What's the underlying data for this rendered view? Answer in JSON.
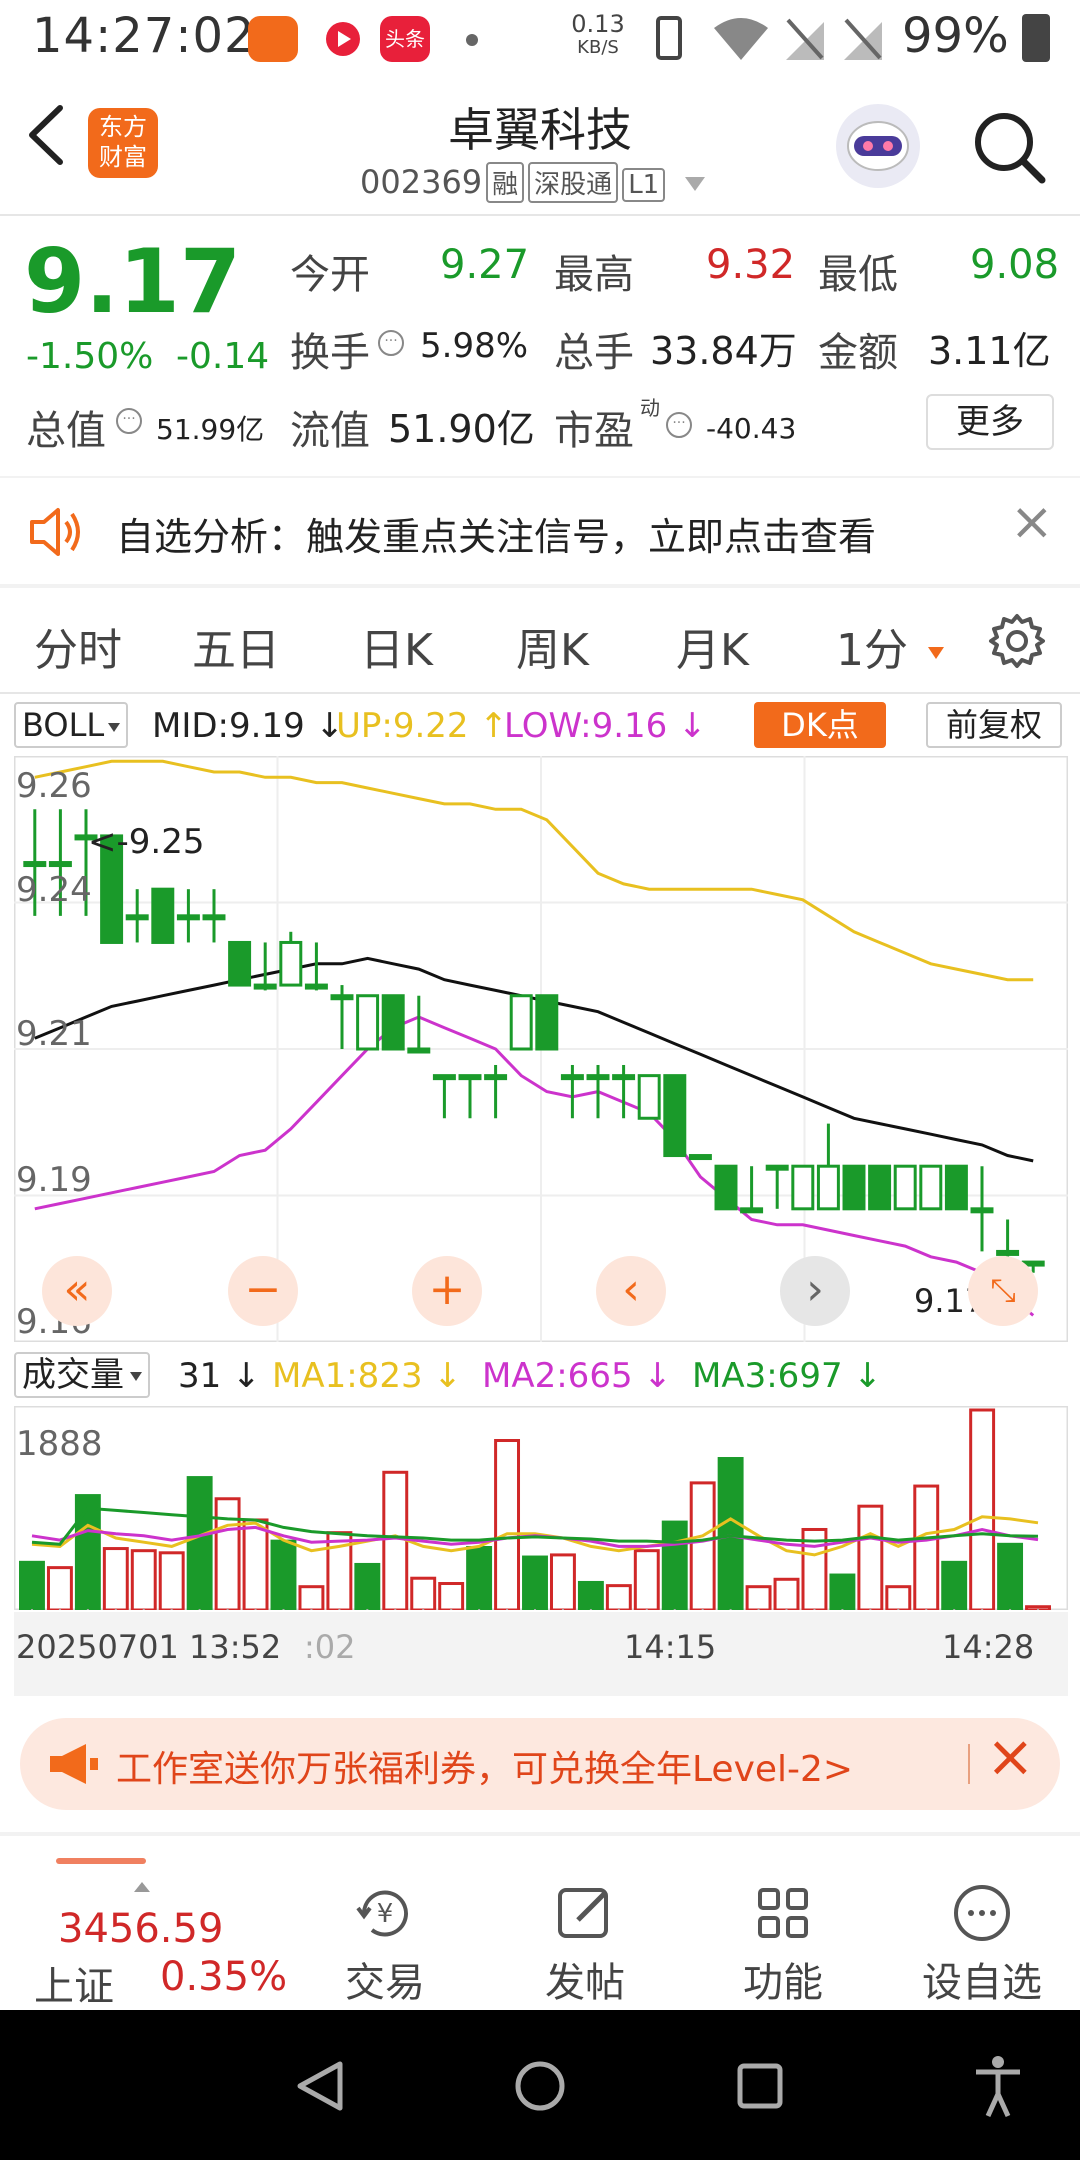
{
  "status": {
    "time": "14:27:02",
    "net_speed_top": "0.13",
    "net_speed_unit": "KB/S",
    "battery": "99%",
    "app_badge_text": "头条"
  },
  "header": {
    "back_label": "‹",
    "logo_text_1": "东方",
    "logo_text_2": "财富",
    "title": "卓翼科技",
    "code": "002369",
    "tag1": "融",
    "tag2": "深股通",
    "tag3": "L1"
  },
  "quote": {
    "price": "9.17",
    "change_pct": "-1.50%",
    "change_val": "-0.14",
    "open_label": "今开",
    "open": "9.27",
    "high_label": "最高",
    "high": "9.32",
    "low_label": "最低",
    "low": "9.08",
    "turnover_label": "换手",
    "turnover": "5.98%",
    "volume_label": "总手",
    "volume": "33.84万",
    "amount_label": "金额",
    "amount": "3.11亿",
    "mktcap_label": "总值",
    "mktcap": "51.99亿",
    "float_label": "流值",
    "float": "51.90亿",
    "pe_label": "市盈",
    "pe_sup": "动",
    "pe": "-40.43",
    "more_label": "更多"
  },
  "notice": {
    "text": "自选分析：触发重点关注信号，立即点击查看",
    "close": "×"
  },
  "tabs": [
    "分时",
    "五日",
    "日K",
    "周K",
    "月K",
    "1分"
  ],
  "indicator": {
    "name": "BOLL",
    "mid": "MID:9.19",
    "up": "UP:9.22",
    "low": "LOW:9.16",
    "dk": "DK点",
    "fq": "前复权"
  },
  "chart_labels": {
    "y_top": "9.26",
    "y2": "9.24",
    "y3": "9.21",
    "y4": "9.19",
    "y5": "9.16",
    "max_mark": "<-9.25",
    "last_mark": "9.17->"
  },
  "volume": {
    "name": "成交量",
    "value": "31",
    "ma1": "MA1:823",
    "ma2": "MA2:665",
    "ma3": "MA3:697",
    "y_max": "1888"
  },
  "time_axis": {
    "start": "20250701 13:52",
    "fragment": ":02",
    "mid": "14:15",
    "end": "14:28"
  },
  "banner": {
    "text": "工作室送你万张福利券，可兑换全年Level-2>",
    "close": "×"
  },
  "index": {
    "value": "3456.59",
    "name": "上证",
    "pct": "0.35%"
  },
  "bottom_nav": [
    "交易",
    "发帖",
    "功能",
    "设自选"
  ],
  "colors": {
    "up": "#d02828",
    "down": "#1a9a2a",
    "mid_line": "#111111",
    "up_line": "#e8c020",
    "low_line": "#cc33cc",
    "accent": "#f26a1b"
  },
  "chart_data": {
    "type": "candlestick",
    "ylim": [
      9.155,
      9.265
    ],
    "candles": [
      {
        "o": 9.245,
        "c": 9.245,
        "h": 9.255,
        "l": 9.235
      },
      {
        "o": 9.245,
        "c": 9.245,
        "h": 9.255,
        "l": 9.235
      },
      {
        "o": 9.25,
        "c": 9.25,
        "h": 9.255,
        "l": 9.235
      },
      {
        "o": 9.25,
        "c": 9.23,
        "h": 9.25,
        "l": 9.23
      },
      {
        "o": 9.235,
        "c": 9.235,
        "h": 9.24,
        "l": 9.23
      },
      {
        "o": 9.24,
        "c": 9.23,
        "h": 9.24,
        "l": 9.23
      },
      {
        "o": 9.235,
        "c": 9.235,
        "h": 9.24,
        "l": 9.23
      },
      {
        "o": 9.235,
        "c": 9.235,
        "h": 9.24,
        "l": 9.23
      },
      {
        "o": 9.23,
        "c": 9.222,
        "h": 9.23,
        "l": 9.222
      },
      {
        "o": 9.222,
        "c": 9.222,
        "h": 9.23,
        "l": 9.221
      },
      {
        "o": 9.222,
        "c": 9.23,
        "h": 9.232,
        "l": 9.222
      },
      {
        "o": 9.222,
        "c": 9.222,
        "h": 9.23,
        "l": 9.221
      },
      {
        "o": 9.22,
        "c": 9.22,
        "h": 9.222,
        "l": 9.21
      },
      {
        "o": 9.21,
        "c": 9.22,
        "h": 9.22,
        "l": 9.21
      },
      {
        "o": 9.22,
        "c": 9.21,
        "h": 9.22,
        "l": 9.21
      },
      {
        "o": 9.21,
        "c": 9.21,
        "h": 9.22,
        "l": 9.21
      },
      {
        "o": 9.205,
        "c": 9.205,
        "h": 9.205,
        "l": 9.197
      },
      {
        "o": 9.205,
        "c": 9.205,
        "h": 9.205,
        "l": 9.197
      },
      {
        "o": 9.205,
        "c": 9.205,
        "h": 9.207,
        "l": 9.197
      },
      {
        "o": 9.21,
        "c": 9.22,
        "h": 9.22,
        "l": 9.21
      },
      {
        "o": 9.22,
        "c": 9.21,
        "h": 9.22,
        "l": 9.21
      },
      {
        "o": 9.205,
        "c": 9.205,
        "h": 9.207,
        "l": 9.197
      },
      {
        "o": 9.205,
        "c": 9.205,
        "h": 9.207,
        "l": 9.197
      },
      {
        "o": 9.205,
        "c": 9.205,
        "h": 9.207,
        "l": 9.197
      },
      {
        "o": 9.197,
        "c": 9.205,
        "h": 9.205,
        "l": 9.197
      },
      {
        "o": 9.205,
        "c": 9.19,
        "h": 9.205,
        "l": 9.19
      },
      {
        "o": 9.19,
        "c": 9.19,
        "h": 9.19,
        "l": 9.19
      },
      {
        "o": 9.188,
        "c": 9.18,
        "h": 9.188,
        "l": 9.18
      },
      {
        "o": 9.18,
        "c": 9.18,
        "h": 9.188,
        "l": 9.18
      },
      {
        "o": 9.188,
        "c": 9.188,
        "h": 9.188,
        "l": 9.18
      },
      {
        "o": 9.18,
        "c": 9.188,
        "h": 9.188,
        "l": 9.18
      },
      {
        "o": 9.18,
        "c": 9.188,
        "h": 9.196,
        "l": 9.18
      },
      {
        "o": 9.188,
        "c": 9.18,
        "h": 9.188,
        "l": 9.18
      },
      {
        "o": 9.188,
        "c": 9.18,
        "h": 9.188,
        "l": 9.18
      },
      {
        "o": 9.18,
        "c": 9.188,
        "h": 9.188,
        "l": 9.18
      },
      {
        "o": 9.18,
        "c": 9.188,
        "h": 9.188,
        "l": 9.18
      },
      {
        "o": 9.188,
        "c": 9.18,
        "h": 9.188,
        "l": 9.18
      },
      {
        "o": 9.18,
        "c": 9.18,
        "h": 9.188,
        "l": 9.172
      },
      {
        "o": 9.172,
        "c": 9.172,
        "h": 9.178,
        "l": 9.165
      },
      {
        "o": 9.17,
        "c": 9.17,
        "h": 9.17,
        "l": 9.168
      }
    ],
    "mid_line": [
      9.212,
      9.214,
      9.216,
      9.218,
      9.219,
      9.22,
      9.221,
      9.222,
      9.223,
      9.224,
      9.225,
      9.226,
      9.226,
      9.227,
      9.226,
      9.225,
      9.223,
      9.222,
      9.221,
      9.22,
      9.219,
      9.218,
      9.217,
      9.215,
      9.213,
      9.211,
      9.209,
      9.207,
      9.205,
      9.203,
      9.201,
      9.199,
      9.197,
      9.196,
      9.195,
      9.194,
      9.193,
      9.192,
      9.19,
      9.189
    ],
    "up_line": [
      9.261,
      9.262,
      9.263,
      9.264,
      9.264,
      9.264,
      9.263,
      9.262,
      9.262,
      9.261,
      9.261,
      9.26,
      9.26,
      9.259,
      9.258,
      9.257,
      9.256,
      9.256,
      9.255,
      9.255,
      9.253,
      9.248,
      9.243,
      9.241,
      9.24,
      9.24,
      9.24,
      9.24,
      9.24,
      9.239,
      9.238,
      9.235,
      9.232,
      9.23,
      9.228,
      9.226,
      9.225,
      9.224,
      9.223,
      9.223
    ],
    "low_line": [
      9.18,
      9.181,
      9.182,
      9.183,
      9.184,
      9.185,
      9.186,
      9.187,
      9.19,
      9.191,
      9.195,
      9.2,
      9.205,
      9.21,
      9.214,
      9.216,
      9.214,
      9.212,
      9.21,
      9.205,
      9.202,
      9.201,
      9.202,
      9.2,
      9.198,
      9.193,
      9.186,
      9.182,
      9.178,
      9.177,
      9.177,
      9.176,
      9.175,
      9.174,
      9.173,
      9.171,
      9.17,
      9.168,
      9.164,
      9.16
    ],
    "volumes": [
      {
        "v": 450,
        "up": false
      },
      {
        "v": 400,
        "up": true
      },
      {
        "v": 1080,
        "up": false
      },
      {
        "v": 580,
        "up": true
      },
      {
        "v": 560,
        "up": true
      },
      {
        "v": 540,
        "up": true
      },
      {
        "v": 1250,
        "up": false
      },
      {
        "v": 1050,
        "up": true
      },
      {
        "v": 850,
        "up": true
      },
      {
        "v": 650,
        "up": false
      },
      {
        "v": 220,
        "up": true
      },
      {
        "v": 730,
        "up": true
      },
      {
        "v": 430,
        "up": false
      },
      {
        "v": 1300,
        "up": true
      },
      {
        "v": 300,
        "up": true
      },
      {
        "v": 250,
        "up": true
      },
      {
        "v": 590,
        "up": false
      },
      {
        "v": 1600,
        "up": true
      },
      {
        "v": 500,
        "up": false
      },
      {
        "v": 520,
        "up": true
      },
      {
        "v": 260,
        "up": false
      },
      {
        "v": 230,
        "up": true
      },
      {
        "v": 560,
        "up": true
      },
      {
        "v": 830,
        "up": false
      },
      {
        "v": 1200,
        "up": true
      },
      {
        "v": 1430,
        "up": false
      },
      {
        "v": 220,
        "up": true
      },
      {
        "v": 290,
        "up": true
      },
      {
        "v": 760,
        "up": true
      },
      {
        "v": 330,
        "up": false
      },
      {
        "v": 980,
        "up": true
      },
      {
        "v": 220,
        "up": true
      },
      {
        "v": 1170,
        "up": true
      },
      {
        "v": 450,
        "up": false
      },
      {
        "v": 1888,
        "up": true
      },
      {
        "v": 620,
        "up": false
      },
      {
        "v": 31,
        "up": true
      }
    ],
    "ma1": [
      620,
      600,
      800,
      680,
      640,
      600,
      700,
      800,
      820,
      660,
      560,
      600,
      650,
      700,
      600,
      560,
      600,
      720,
      720,
      680,
      600,
      560,
      600,
      640,
      700,
      860,
      700,
      560,
      520,
      600,
      720,
      600,
      720,
      760,
      880,
      860,
      823
    ],
    "ma2": [
      700,
      660,
      750,
      720,
      700,
      660,
      700,
      760,
      780,
      700,
      640,
      650,
      660,
      680,
      650,
      620,
      640,
      680,
      700,
      680,
      650,
      600,
      600,
      620,
      650,
      700,
      660,
      620,
      600,
      640,
      680,
      640,
      660,
      700,
      760,
      700,
      665
    ],
    "ma3": [
      640,
      620,
      960,
      940,
      920,
      900,
      880,
      860,
      850,
      780,
      740,
      720,
      700,
      690,
      680,
      660,
      660,
      680,
      690,
      680,
      670,
      650,
      650,
      640,
      660,
      700,
      680,
      660,
      650,
      660,
      690,
      660,
      680,
      700,
      720,
      700,
      697
    ]
  }
}
